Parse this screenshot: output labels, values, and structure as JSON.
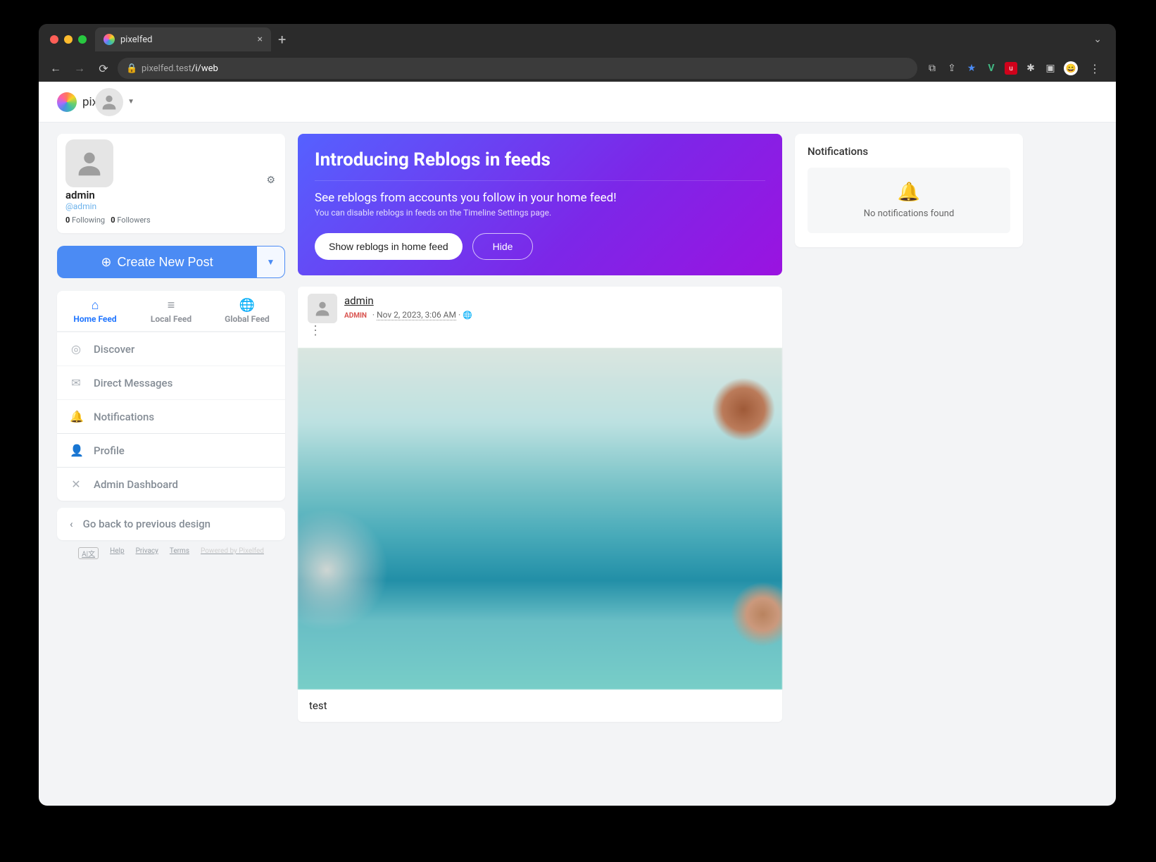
{
  "browser": {
    "tab_title": "pixelfed",
    "url_host": "pixelfed.test",
    "url_path": "/i/web"
  },
  "header": {
    "brand_text": "pix"
  },
  "profile": {
    "name": "admin",
    "handle": "@admin",
    "following_count": "0",
    "following_label": "Following",
    "followers_count": "0",
    "followers_label": "Followers"
  },
  "create_post_label": "Create New Post",
  "feed_tabs": {
    "home": "Home Feed",
    "local": "Local Feed",
    "global": "Global Feed"
  },
  "menu": {
    "discover": "Discover",
    "dms": "Direct Messages",
    "notifications": "Notifications",
    "profile": "Profile",
    "admin": "Admin Dashboard",
    "go_back": "Go back to previous design"
  },
  "footer": {
    "help": "Help",
    "privacy": "Privacy",
    "terms": "Terms",
    "powered": "Powered by Pixelfed"
  },
  "banner": {
    "title": "Introducing Reblogs in feeds",
    "subtitle": "See reblogs from accounts you follow in your home feed!",
    "note": "You can disable reblogs in feeds on the Timeline Settings page.",
    "show_btn": "Show reblogs in home feed",
    "hide_btn": "Hide"
  },
  "post": {
    "author": "admin",
    "badge": "ADMIN",
    "timestamp": "Nov 2, 2023, 3:06 AM",
    "caption": "test"
  },
  "notifications": {
    "title": "Notifications",
    "empty": "No notifications found"
  }
}
